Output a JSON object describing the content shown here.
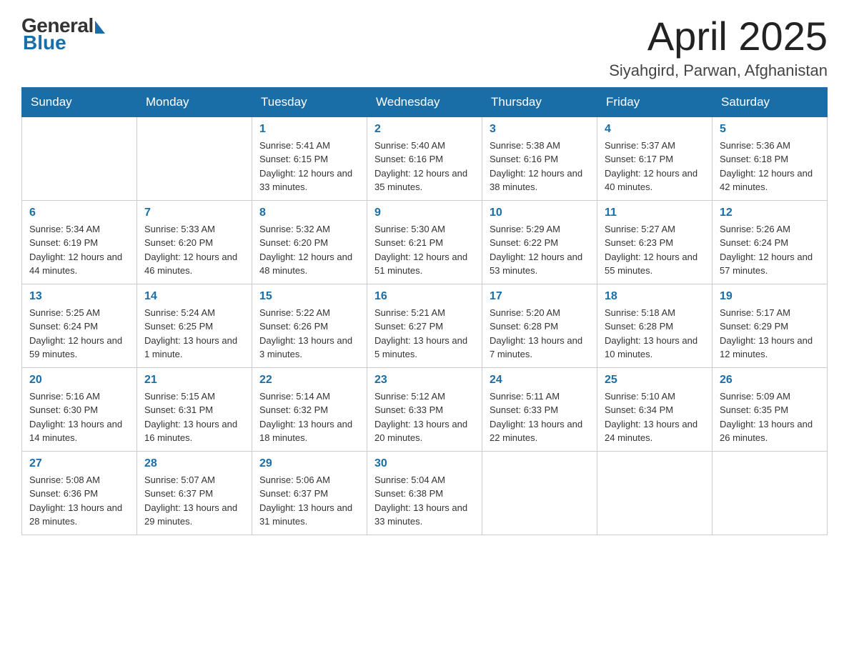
{
  "header": {
    "logo": {
      "general": "General",
      "blue": "Blue"
    },
    "title": "April 2025",
    "location": "Siyahgird, Parwan, Afghanistan"
  },
  "days_of_week": [
    "Sunday",
    "Monday",
    "Tuesday",
    "Wednesday",
    "Thursday",
    "Friday",
    "Saturday"
  ],
  "weeks": [
    [
      {
        "day": "",
        "info": ""
      },
      {
        "day": "",
        "info": ""
      },
      {
        "day": "1",
        "info": "Sunrise: 5:41 AM\nSunset: 6:15 PM\nDaylight: 12 hours\nand 33 minutes."
      },
      {
        "day": "2",
        "info": "Sunrise: 5:40 AM\nSunset: 6:16 PM\nDaylight: 12 hours\nand 35 minutes."
      },
      {
        "day": "3",
        "info": "Sunrise: 5:38 AM\nSunset: 6:16 PM\nDaylight: 12 hours\nand 38 minutes."
      },
      {
        "day": "4",
        "info": "Sunrise: 5:37 AM\nSunset: 6:17 PM\nDaylight: 12 hours\nand 40 minutes."
      },
      {
        "day": "5",
        "info": "Sunrise: 5:36 AM\nSunset: 6:18 PM\nDaylight: 12 hours\nand 42 minutes."
      }
    ],
    [
      {
        "day": "6",
        "info": "Sunrise: 5:34 AM\nSunset: 6:19 PM\nDaylight: 12 hours\nand 44 minutes."
      },
      {
        "day": "7",
        "info": "Sunrise: 5:33 AM\nSunset: 6:20 PM\nDaylight: 12 hours\nand 46 minutes."
      },
      {
        "day": "8",
        "info": "Sunrise: 5:32 AM\nSunset: 6:20 PM\nDaylight: 12 hours\nand 48 minutes."
      },
      {
        "day": "9",
        "info": "Sunrise: 5:30 AM\nSunset: 6:21 PM\nDaylight: 12 hours\nand 51 minutes."
      },
      {
        "day": "10",
        "info": "Sunrise: 5:29 AM\nSunset: 6:22 PM\nDaylight: 12 hours\nand 53 minutes."
      },
      {
        "day": "11",
        "info": "Sunrise: 5:27 AM\nSunset: 6:23 PM\nDaylight: 12 hours\nand 55 minutes."
      },
      {
        "day": "12",
        "info": "Sunrise: 5:26 AM\nSunset: 6:24 PM\nDaylight: 12 hours\nand 57 minutes."
      }
    ],
    [
      {
        "day": "13",
        "info": "Sunrise: 5:25 AM\nSunset: 6:24 PM\nDaylight: 12 hours\nand 59 minutes."
      },
      {
        "day": "14",
        "info": "Sunrise: 5:24 AM\nSunset: 6:25 PM\nDaylight: 13 hours\nand 1 minute."
      },
      {
        "day": "15",
        "info": "Sunrise: 5:22 AM\nSunset: 6:26 PM\nDaylight: 13 hours\nand 3 minutes."
      },
      {
        "day": "16",
        "info": "Sunrise: 5:21 AM\nSunset: 6:27 PM\nDaylight: 13 hours\nand 5 minutes."
      },
      {
        "day": "17",
        "info": "Sunrise: 5:20 AM\nSunset: 6:28 PM\nDaylight: 13 hours\nand 7 minutes."
      },
      {
        "day": "18",
        "info": "Sunrise: 5:18 AM\nSunset: 6:28 PM\nDaylight: 13 hours\nand 10 minutes."
      },
      {
        "day": "19",
        "info": "Sunrise: 5:17 AM\nSunset: 6:29 PM\nDaylight: 13 hours\nand 12 minutes."
      }
    ],
    [
      {
        "day": "20",
        "info": "Sunrise: 5:16 AM\nSunset: 6:30 PM\nDaylight: 13 hours\nand 14 minutes."
      },
      {
        "day": "21",
        "info": "Sunrise: 5:15 AM\nSunset: 6:31 PM\nDaylight: 13 hours\nand 16 minutes."
      },
      {
        "day": "22",
        "info": "Sunrise: 5:14 AM\nSunset: 6:32 PM\nDaylight: 13 hours\nand 18 minutes."
      },
      {
        "day": "23",
        "info": "Sunrise: 5:12 AM\nSunset: 6:33 PM\nDaylight: 13 hours\nand 20 minutes."
      },
      {
        "day": "24",
        "info": "Sunrise: 5:11 AM\nSunset: 6:33 PM\nDaylight: 13 hours\nand 22 minutes."
      },
      {
        "day": "25",
        "info": "Sunrise: 5:10 AM\nSunset: 6:34 PM\nDaylight: 13 hours\nand 24 minutes."
      },
      {
        "day": "26",
        "info": "Sunrise: 5:09 AM\nSunset: 6:35 PM\nDaylight: 13 hours\nand 26 minutes."
      }
    ],
    [
      {
        "day": "27",
        "info": "Sunrise: 5:08 AM\nSunset: 6:36 PM\nDaylight: 13 hours\nand 28 minutes."
      },
      {
        "day": "28",
        "info": "Sunrise: 5:07 AM\nSunset: 6:37 PM\nDaylight: 13 hours\nand 29 minutes."
      },
      {
        "day": "29",
        "info": "Sunrise: 5:06 AM\nSunset: 6:37 PM\nDaylight: 13 hours\nand 31 minutes."
      },
      {
        "day": "30",
        "info": "Sunrise: 5:04 AM\nSunset: 6:38 PM\nDaylight: 13 hours\nand 33 minutes."
      },
      {
        "day": "",
        "info": ""
      },
      {
        "day": "",
        "info": ""
      },
      {
        "day": "",
        "info": ""
      }
    ]
  ]
}
